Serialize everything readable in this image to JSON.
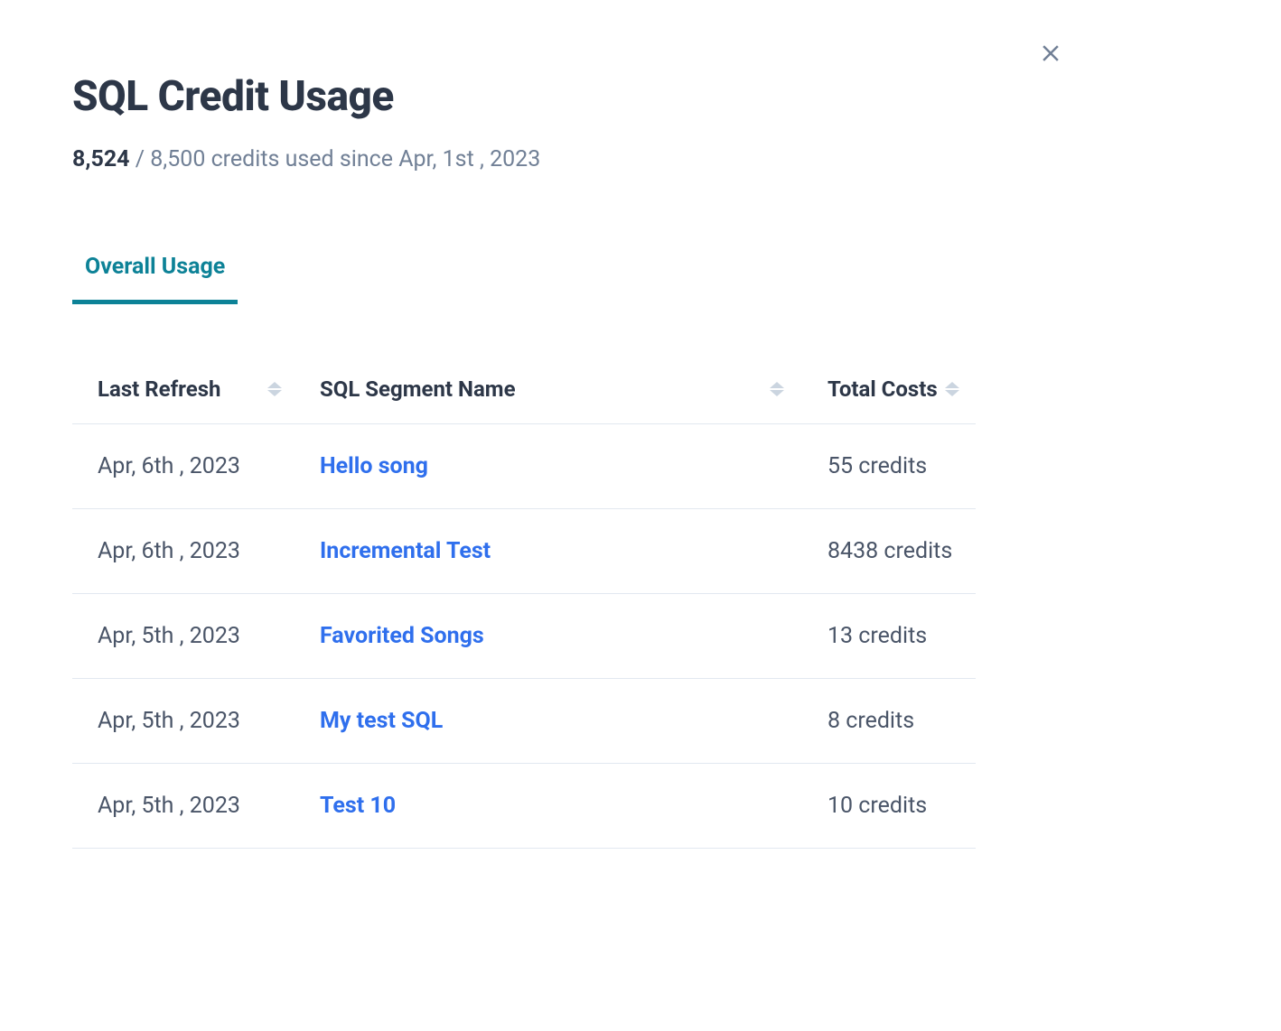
{
  "header": {
    "title": "SQL Credit Usage",
    "credits_used": "8,524",
    "credits_suffix": " / 8,500 credits used since Apr, 1st , 2023"
  },
  "tabs": {
    "overall_usage": "Overall Usage"
  },
  "table": {
    "columns": {
      "last_refresh": "Last Refresh",
      "segment_name": "SQL Segment Name",
      "total_costs": "Total Costs"
    },
    "rows": [
      {
        "last_refresh": "Apr, 6th , 2023",
        "segment_name": "Hello song",
        "total_costs": "55 credits"
      },
      {
        "last_refresh": "Apr, 6th , 2023",
        "segment_name": "Incremental Test",
        "total_costs": "8438 credits"
      },
      {
        "last_refresh": "Apr, 5th , 2023",
        "segment_name": "Favorited Songs",
        "total_costs": "13 credits"
      },
      {
        "last_refresh": "Apr, 5th , 2023",
        "segment_name": "My test SQL",
        "total_costs": "8 credits"
      },
      {
        "last_refresh": "Apr, 5th , 2023",
        "segment_name": "Test 10",
        "total_costs": "10 credits"
      }
    ]
  }
}
